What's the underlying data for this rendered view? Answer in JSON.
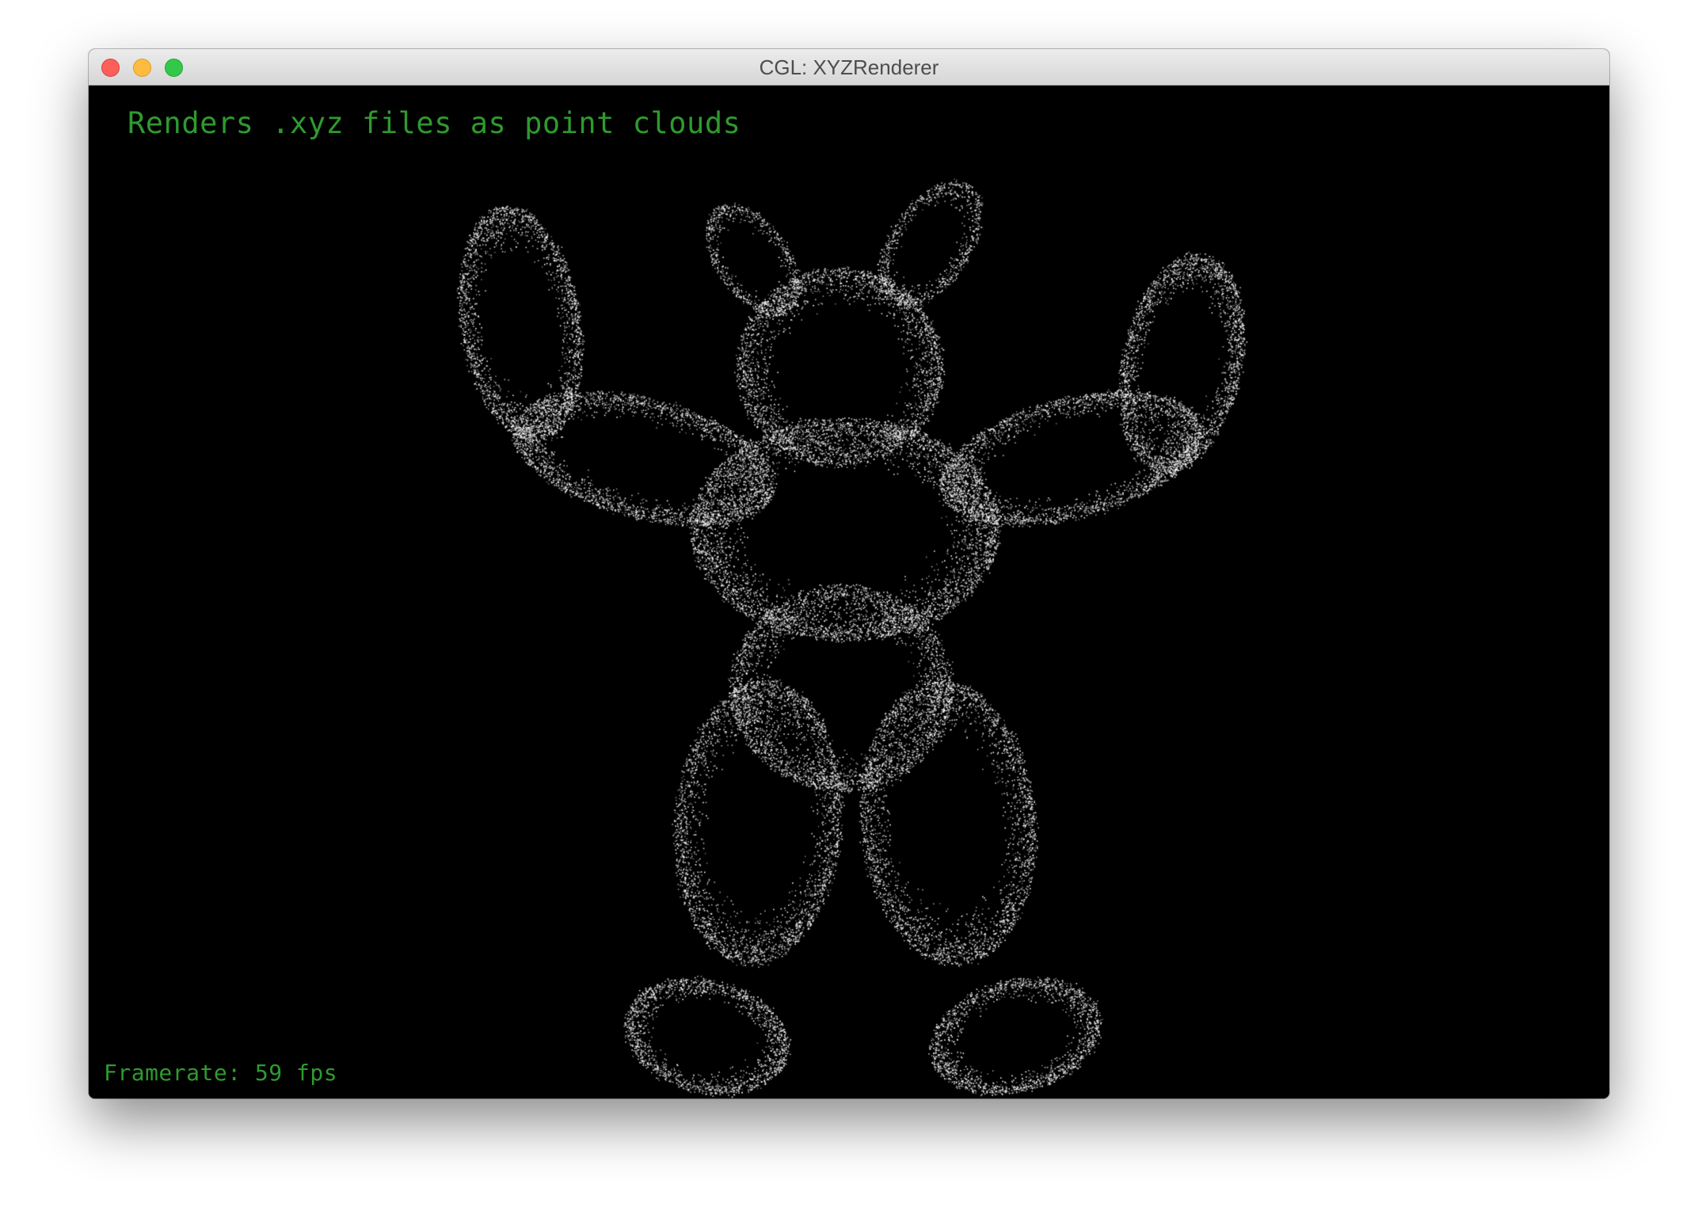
{
  "window": {
    "title": "CGL: XYZRenderer",
    "controls": {
      "close_icon": "close-icon",
      "minimize_icon": "minimize-icon",
      "zoom_icon": "zoom-icon"
    }
  },
  "viewport": {
    "description": "Renders .xyz files as point clouds",
    "framerate": "Framerate: 59 fps",
    "background_color": "#000000",
    "text_color": "#2f9a2f",
    "point_color": "#ffffff"
  }
}
